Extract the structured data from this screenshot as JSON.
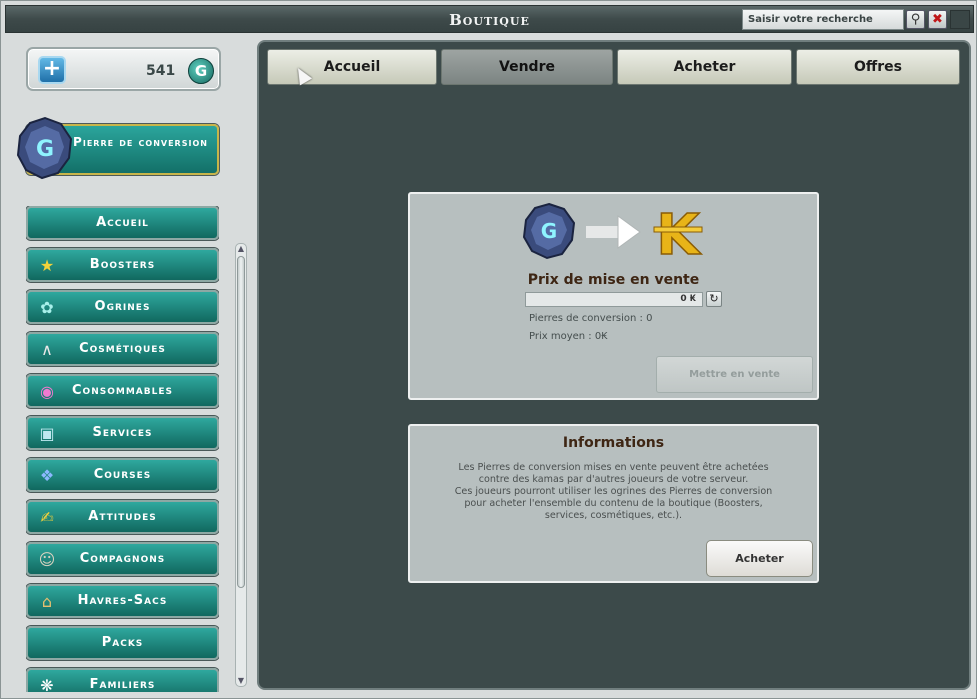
{
  "window": {
    "title": "Boutique"
  },
  "search": {
    "placeholder": "Saisir votre recherche"
  },
  "wallet": {
    "ogrines": "541"
  },
  "pierre_button": {
    "label": "Pierre de conversion"
  },
  "menu": {
    "items": [
      {
        "label": "Accueil",
        "icon": "home-icon"
      },
      {
        "label": "Boosters",
        "icon": "star-icon"
      },
      {
        "label": "Ogrines",
        "icon": "ogrine-icon"
      },
      {
        "label": "Cosmétiques",
        "icon": "hanger-icon"
      },
      {
        "label": "Consommables",
        "icon": "potion-icon"
      },
      {
        "label": "Services",
        "icon": "chest-icon"
      },
      {
        "label": "Courses",
        "icon": "crystal-icon"
      },
      {
        "label": "Attitudes",
        "icon": "attitude-icon"
      },
      {
        "label": "Compagnons",
        "icon": "companion-icon"
      },
      {
        "label": "Havres-Sacs",
        "icon": "house-icon"
      },
      {
        "label": "Packs",
        "icon": "pack-icon"
      },
      {
        "label": "Familiers",
        "icon": "pet-icon"
      }
    ]
  },
  "tabs": [
    {
      "label": "Accueil"
    },
    {
      "label": "Vendre"
    },
    {
      "label": "Acheter"
    },
    {
      "label": "Offres"
    }
  ],
  "sell": {
    "title": "Prix de mise en vente",
    "price_value": "0 ₭",
    "stones_label": "Pierres de conversion : 0",
    "average_label": "Prix moyen : 0₭",
    "sell_button": "Mettre en vente"
  },
  "info": {
    "title": "Informations",
    "line1": "Les Pierres de conversion mises en vente peuvent être achetées",
    "line2": "contre des kamas par d'autres joueurs de votre serveur.",
    "line3": "Ces joueurs pourront utiliser les ogrines des Pierres de conversion",
    "line4": "pour acheter l'ensemble du contenu de la boutique (Boosters,",
    "line5": "services, cosmétiques, etc.).",
    "buy_button": "Acheter"
  },
  "colors": {
    "teal": "#1e8a80",
    "gold": "#e8b418",
    "panel": "#b7bfbf"
  }
}
